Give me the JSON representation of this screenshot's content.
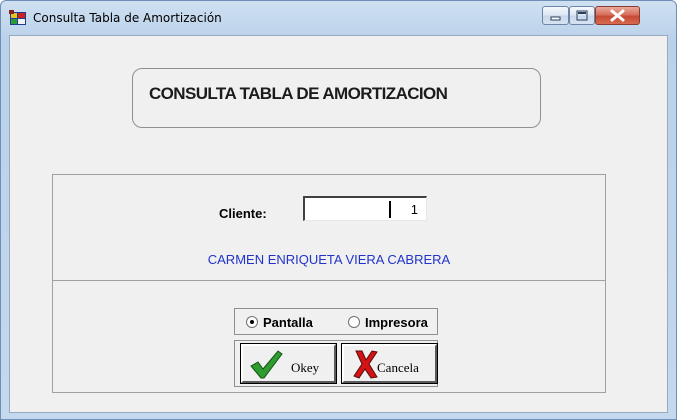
{
  "window": {
    "title": "Consulta Tabla de Amortización"
  },
  "header": {
    "title": "CONSULTA TABLA DE AMORTIZACION"
  },
  "form": {
    "cliente_label": "Cliente:",
    "cliente_value": "1",
    "client_name": "CARMEN ENRIQUETA VIERA CABRERA"
  },
  "output": {
    "options": [
      "Pantalla",
      "Impresora"
    ],
    "selected": "Pantalla"
  },
  "buttons": {
    "ok_label": "Okey",
    "cancel_label": "Cancela"
  },
  "icons": {
    "app": "app-icon",
    "ok": "checkmark-icon",
    "cancel": "x-icon"
  },
  "colors": {
    "client_name": "#2233cc",
    "checkmark": "#2e9c2e",
    "x_mark": "#d21414"
  }
}
